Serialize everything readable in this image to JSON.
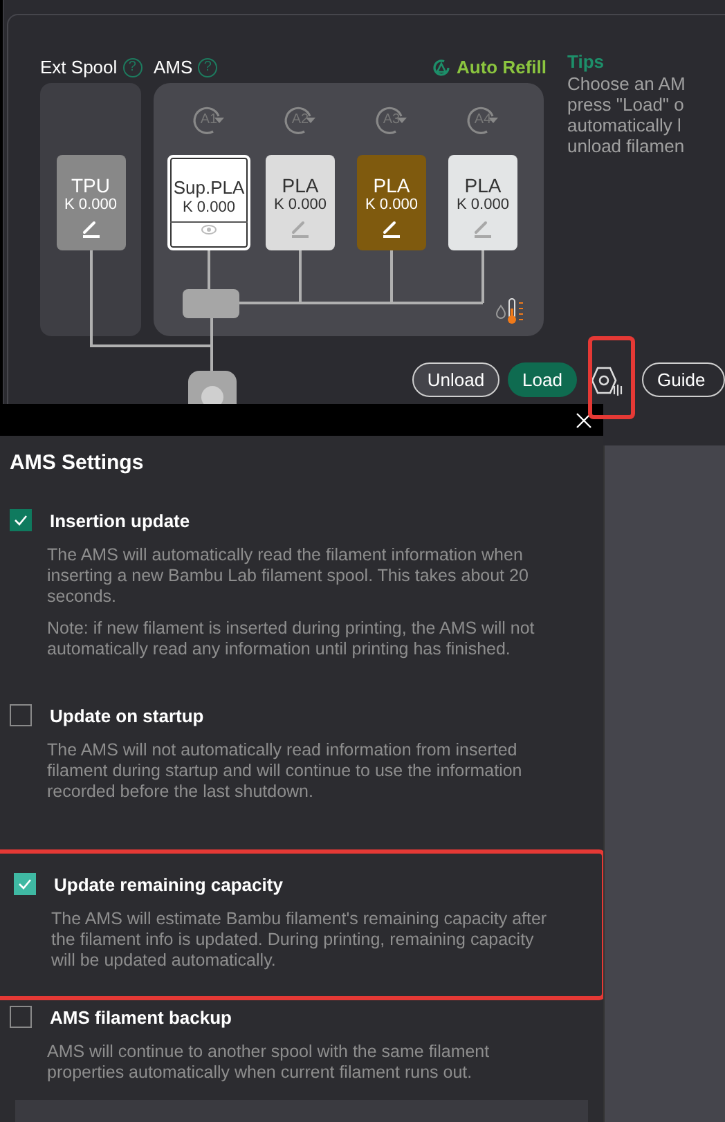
{
  "ams_panel": {
    "ext_spool": {
      "label": "Ext Spool",
      "help_icon": "?",
      "card": {
        "material": "TPU",
        "k_value": "K 0.000",
        "color": "#888888"
      }
    },
    "ams": {
      "label": "AMS",
      "help_icon": "?",
      "auto_refill": "Auto Refill",
      "slots": [
        {
          "label": "A1",
          "material": "Sup.PLA",
          "k_value": "K 0.000",
          "color": "#ffffff",
          "selected": true
        },
        {
          "label": "A2",
          "material": "PLA",
          "k_value": "K 0.000",
          "color": "#dcdcdc",
          "selected": false
        },
        {
          "label": "A3",
          "material": "PLA",
          "k_value": "K 0.000",
          "color": "#7f5a0e",
          "selected": false
        },
        {
          "label": "A4",
          "material": "PLA",
          "k_value": "K 0.000",
          "color": "#e3e5e6",
          "selected": false
        }
      ]
    },
    "tips": {
      "title": "Tips",
      "lines": [
        "Choose an AM",
        "press \"Load\" o",
        "automatically l",
        "unload filamen"
      ]
    },
    "buttons": {
      "unload": "Unload",
      "load": "Load",
      "guide": "Guide"
    },
    "settings_highlighted": true
  },
  "dialog": {
    "title": "AMS Settings",
    "options": [
      {
        "label": "Insertion update",
        "checked": true,
        "highlighted": false,
        "descriptions": [
          "The AMS will automatically read the filament information when inserting a new Bambu Lab filament spool. This takes about 20 seconds.",
          "Note: if new filament is inserted during  printing, the AMS will not automatically read any information until printing has finished."
        ]
      },
      {
        "label": "Update on startup",
        "checked": false,
        "highlighted": false,
        "descriptions": [
          "The AMS will not automatically read information from inserted filament during startup and will continue to use the information recorded before the last shutdown."
        ]
      },
      {
        "label": "Update remaining capacity",
        "checked": true,
        "highlighted": true,
        "descriptions": [
          "The AMS will estimate Bambu filament's remaining capacity after the filament info is updated. During printing, remaining capacity will be updated automatically."
        ]
      },
      {
        "label": "AMS filament backup",
        "checked": false,
        "highlighted": false,
        "descriptions": [
          "AMS will continue to another spool with the same filament properties automatically when current filament runs out."
        ]
      }
    ]
  }
}
